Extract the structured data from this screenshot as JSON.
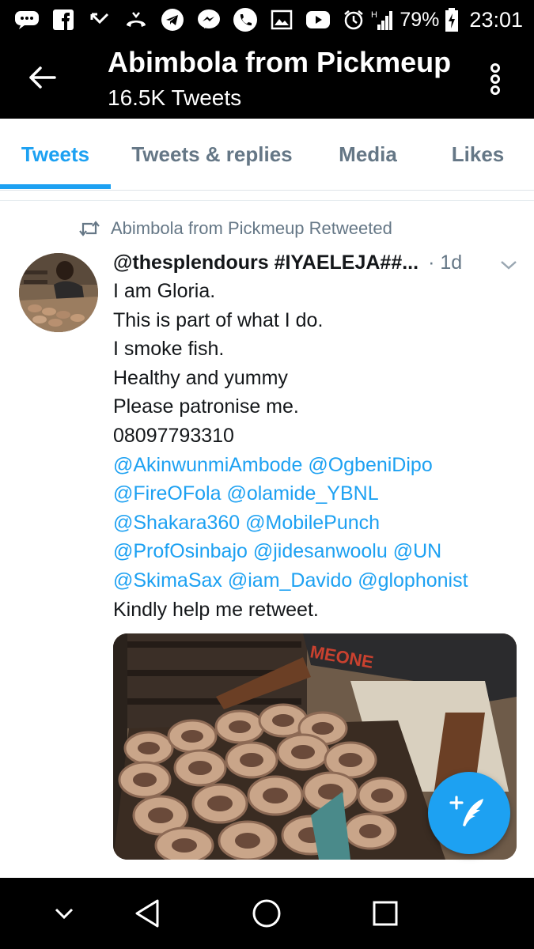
{
  "status_bar": {
    "battery": "79%",
    "time": "23:01",
    "icons": [
      "messages-icon",
      "facebook-icon",
      "missed-call-icon",
      "call-forward-icon",
      "telegram-icon",
      "messenger-icon",
      "whatsapp-icon",
      "gallery-icon",
      "youtube-icon",
      "alarm-icon",
      "signal-icon",
      "battery-charging-icon"
    ]
  },
  "header": {
    "title": "Abimbola from Pickmeup",
    "subtitle": "16.5K Tweets"
  },
  "tabs": [
    {
      "label": "Tweets",
      "active": true
    },
    {
      "label": "Tweets & replies",
      "active": false
    },
    {
      "label": "Media",
      "active": false
    },
    {
      "label": "Likes",
      "active": false
    }
  ],
  "tweet": {
    "retweet_label": "Abimbola from Pickmeup Retweeted",
    "handle": "@thesplendours #IYAELEJA##...",
    "time": "· 1d",
    "lines": {
      "l1": "I am Gloria.",
      "l2": "This is part of what I do.",
      "l3": "I smoke fish.",
      "l4": "Healthy and yummy",
      "l5": "Please patronise me.",
      "l6": "08097793310",
      "l7": "@AkinwunmiAmbode @OgbeniDipo",
      "l8": "@FireOFola @olamide_YBNL",
      "l9": "@Shakara360 @MobilePunch",
      "l10": "@ProfOsinbajo @jidesanwoolu @UN",
      "l11": "@SkimaSax @iam_Davido @glophonist",
      "l12": "Kindly help me retweet."
    }
  },
  "colors": {
    "accent": "#1da1f2",
    "secondary_text": "#657786",
    "primary_text": "#14171a",
    "bar_background": "#000000"
  }
}
